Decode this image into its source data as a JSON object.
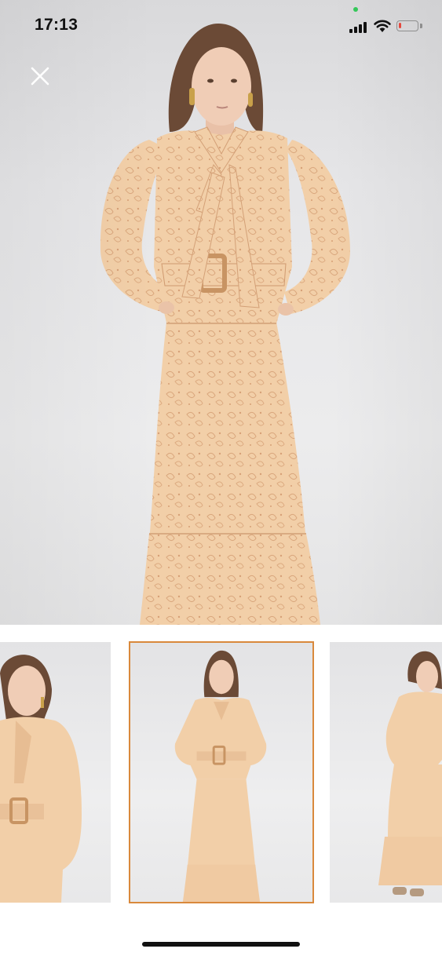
{
  "status_bar": {
    "time": "17:13",
    "signal_icon": "cellular-signal-icon",
    "wifi_icon": "wifi-icon",
    "battery_icon": "battery-icon",
    "battery_level": 0.15,
    "battery_color": "#e5483d",
    "privacy_dot_color": "#34c759"
  },
  "gallery": {
    "close_icon": "close-icon",
    "main_image_subject": "model-in-peach-paisley-maxi-dress",
    "thumbnails": [
      {
        "subject": "dress-front-closeup",
        "selected": false
      },
      {
        "subject": "dress-front-full-length",
        "selected": true
      },
      {
        "subject": "dress-side-view",
        "selected": false
      }
    ],
    "accent_color": "#d9893c",
    "dress_color": "#f1cda6"
  }
}
